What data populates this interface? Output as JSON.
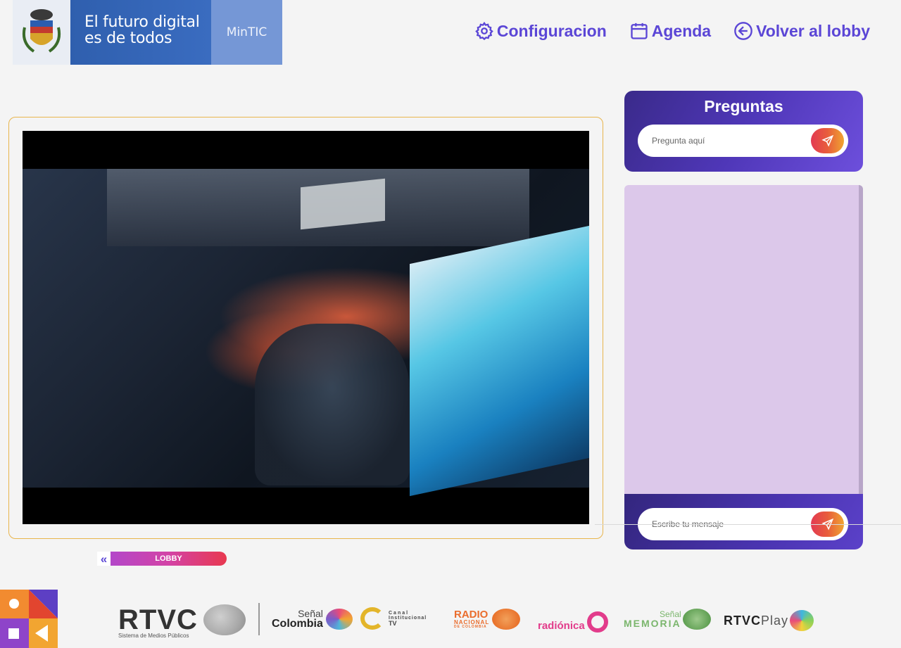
{
  "header": {
    "brand_line1": "El futuro digital",
    "brand_line2": "es de todos",
    "brand_ministry": "MinTIC"
  },
  "nav": {
    "settings_label": "Configuracion",
    "settings_icon": "gear-icon",
    "agenda_label": "Agenda",
    "agenda_icon": "calendar-icon",
    "lobby_label": "Volver al lobby",
    "lobby_icon": "arrow-left-circle-icon",
    "color": "#5b46d6"
  },
  "questions": {
    "title": "Preguntas",
    "placeholder": "Pregunta aquí"
  },
  "chat": {
    "placeholder": "Escribe tu mensaje"
  },
  "lobby_button": {
    "chevron": "«",
    "label": "LOBBY"
  },
  "footer": {
    "logos": {
      "rtvc": "RTVC",
      "rtvc_sub": "Sistema de Medios Públicos",
      "senal_colombia_1": "Señal",
      "senal_colombia_2": "Colombia",
      "canal_inst_1": "Canal",
      "canal_inst_2": "Institucional",
      "canal_inst_3": "TV",
      "radio_nacional_1": "RADIO",
      "radio_nacional_2": "NACIONAL",
      "radio_nacional_3": "DE COLOMBIA",
      "radionica": "radiónica",
      "senal_memoria_1": "Señal",
      "senal_memoria_2": "MEMORIA",
      "rtvc_play_1": "RTVC",
      "rtvc_play_2": "Play"
    }
  },
  "colors": {
    "accent": "#5b46d6",
    "video_border": "#e8b54c",
    "chat_bg": "#dcc8ea",
    "send_gradient_start": "#e33a52",
    "send_gradient_end": "#f0a431"
  }
}
